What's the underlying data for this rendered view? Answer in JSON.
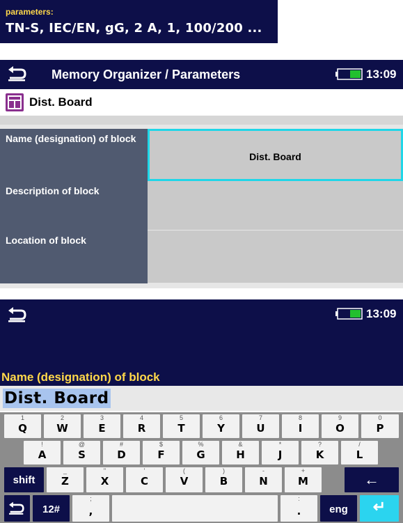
{
  "parameters": {
    "label": "parameters:",
    "value": "TN-S, IEC/EN, gG, 2 A, 1, 100/200 ..."
  },
  "screen1": {
    "title": "Memory Organizer / Parameters",
    "time": "13:09",
    "breadcrumb": "Dist. Board",
    "rows": [
      {
        "label": "Name (designation) of block",
        "value": "Dist. Board"
      },
      {
        "label": "Description of block",
        "value": ""
      },
      {
        "label": "Location of block",
        "value": ""
      }
    ]
  },
  "screen2": {
    "time": "13:09",
    "field_caption": "Name (designation) of block",
    "input_value": "Dist. Board",
    "keyboard": {
      "row1": [
        {
          "alt": "1",
          "main": "Q"
        },
        {
          "alt": "2",
          "main": "W"
        },
        {
          "alt": "3",
          "main": "E"
        },
        {
          "alt": "4",
          "main": "R"
        },
        {
          "alt": "5",
          "main": "T"
        },
        {
          "alt": "6",
          "main": "Y"
        },
        {
          "alt": "7",
          "main": "U"
        },
        {
          "alt": "8",
          "main": "I"
        },
        {
          "alt": "9",
          "main": "O"
        },
        {
          "alt": "0",
          "main": "P"
        }
      ],
      "row2": [
        {
          "alt": "!",
          "main": "A"
        },
        {
          "alt": "@",
          "main": "S"
        },
        {
          "alt": "#",
          "main": "D"
        },
        {
          "alt": "$",
          "main": "F"
        },
        {
          "alt": "%",
          "main": "G"
        },
        {
          "alt": "&",
          "main": "H"
        },
        {
          "alt": "*",
          "main": "J"
        },
        {
          "alt": "?",
          "main": "K"
        },
        {
          "alt": "/",
          "main": "L"
        }
      ],
      "row3": [
        {
          "alt": "_",
          "main": "Z"
        },
        {
          "alt": "\"",
          "main": "X"
        },
        {
          "alt": "'",
          "main": "C"
        },
        {
          "alt": "(",
          "main": "V"
        },
        {
          "alt": ")",
          "main": "B"
        },
        {
          "alt": "-",
          "main": "N"
        },
        {
          "alt": "+",
          "main": "M"
        }
      ],
      "shift_label": "shift",
      "backspace_glyph": "←",
      "numeric_label": "12#",
      "comma": {
        "alt": ";",
        "main": ","
      },
      "period": {
        "alt": ":",
        "main": "."
      },
      "language_label": "eng",
      "enter_glyph": "↵"
    }
  },
  "colors": {
    "header_bg": "#0d0f49",
    "caption_yellow": "#ffd84a",
    "label_bg": "#505a70",
    "value_bg": "#c9c9c9",
    "selection": "#1fd6e8",
    "enter_key": "#2bd4ef"
  },
  "icons": {
    "back": "back-arrow-icon",
    "battery": "battery-icon",
    "block": "distribution-board-icon",
    "backspace": "backspace-arrow-icon",
    "enter": "enter-icon"
  }
}
